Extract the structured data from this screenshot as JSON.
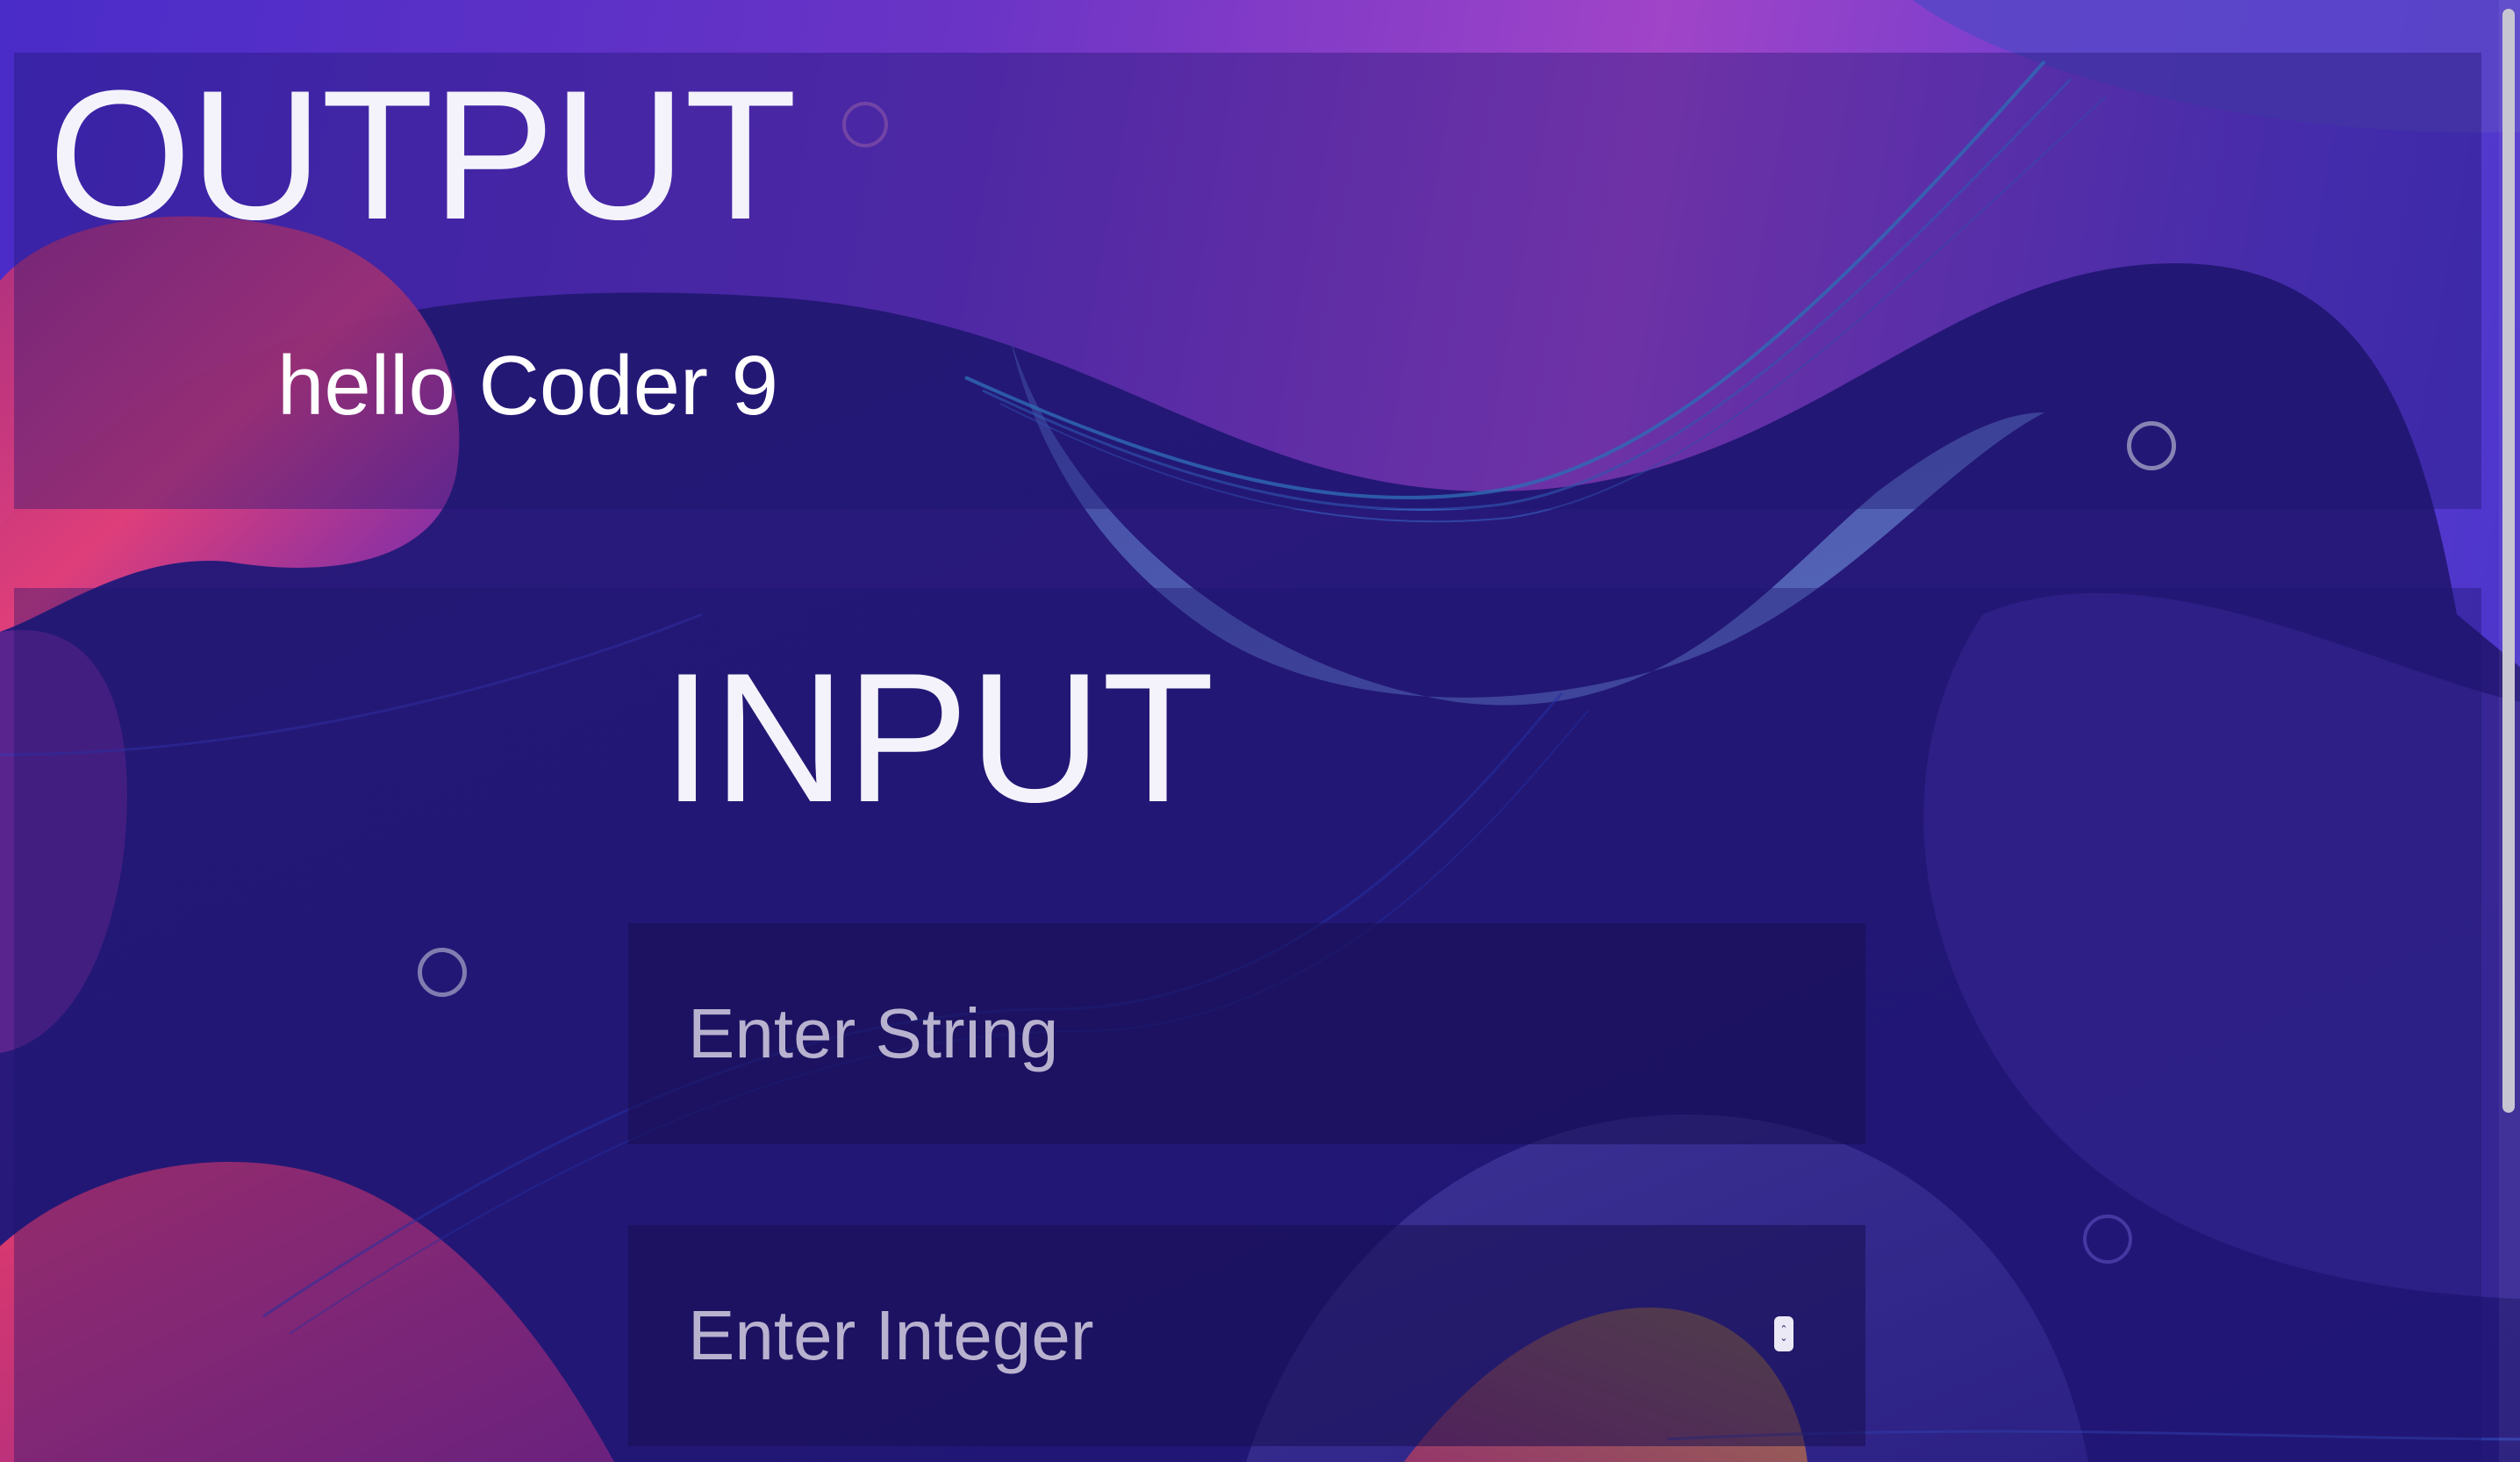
{
  "output": {
    "title": "OUTPUT",
    "text": "hello Coder 9"
  },
  "input": {
    "title": "INPUT",
    "string_placeholder": "Enter String",
    "integer_placeholder": "Enter Integer"
  },
  "theme": {
    "panel_overlay": "#1e166e",
    "text": "#ffffff",
    "placeholder": "#b8b2cf"
  },
  "icons": {
    "spinner": "number-spinner-icon",
    "bubble": "circle-outline-icon"
  }
}
